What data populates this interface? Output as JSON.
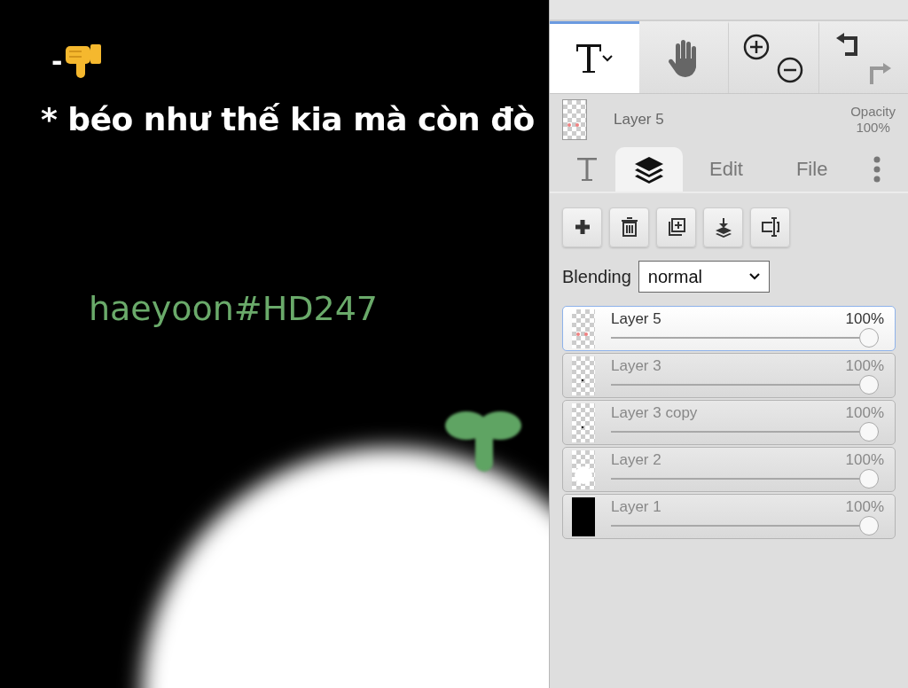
{
  "canvas": {
    "dash": "-",
    "caption": "* béo như thế kia mà còn đò",
    "signature": "haeyoon#HD247"
  },
  "tools": [
    {
      "kind": "text",
      "selected": true
    },
    {
      "kind": "hand",
      "selected": false
    }
  ],
  "current_layer": {
    "name": "Layer 5",
    "opacity_label": "Opacity",
    "opacity": "100%"
  },
  "tabs": [
    {
      "kind": "text",
      "selected": false
    },
    {
      "kind": "layers",
      "selected": true
    },
    {
      "kind": "label",
      "label": "Edit",
      "selected": false
    },
    {
      "kind": "label",
      "label": "File",
      "selected": false
    },
    {
      "kind": "more",
      "selected": false
    }
  ],
  "blending": {
    "label": "Blending",
    "value": "normal"
  },
  "layers": [
    {
      "name": "Layer 5",
      "opacity": "100%",
      "level": 1,
      "selected": true,
      "kind": "dots"
    },
    {
      "name": "Layer 3",
      "opacity": "100%",
      "level": 1,
      "selected": false,
      "kind": "speck"
    },
    {
      "name": "Layer 3 copy",
      "opacity": "100%",
      "level": 1,
      "selected": false,
      "kind": "speck"
    },
    {
      "name": "Layer 2",
      "opacity": "100%",
      "level": 1,
      "selected": false,
      "kind": "circle"
    },
    {
      "name": "Layer 1",
      "opacity": "100%",
      "level": 1,
      "selected": false,
      "kind": "solid"
    }
  ]
}
